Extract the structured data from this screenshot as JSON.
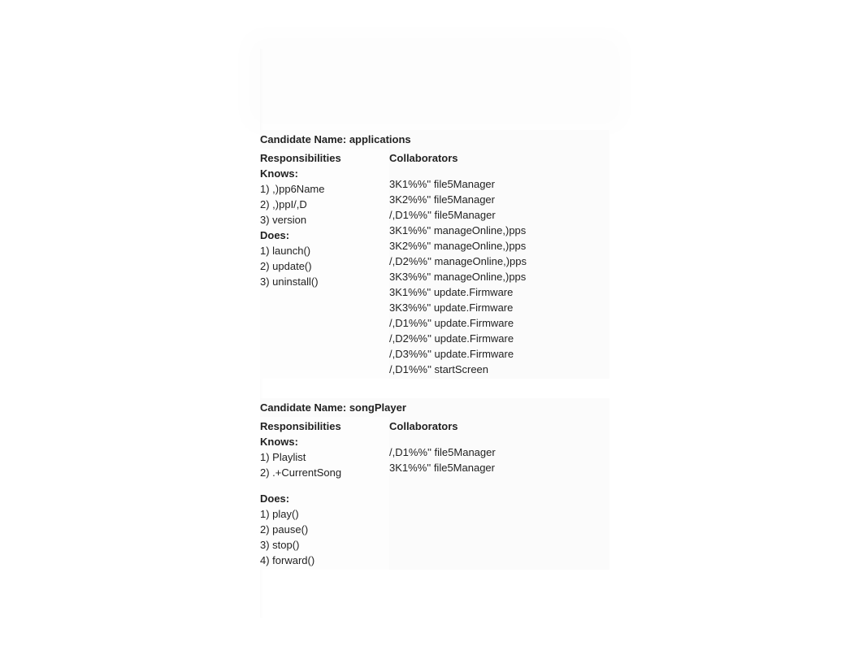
{
  "cards": [
    {
      "titlePrefix": "Candidate Name: ",
      "titleName": "applications",
      "respHeader": "Responsibilities",
      "collabHeader": "Collaborators",
      "knowsLabel": "Knows:",
      "knows": [
        "1) ,)pp6Name",
        "2) ,)ppI/,D",
        "3) version"
      ],
      "doesLabel": "Does:",
      "does": [
        "1) launch()",
        "2) update()",
        "3) uninstall()"
      ],
      "collabs": [
        "3K1%%'' file5Manager",
        "3K2%%'' file5Manager",
        "/,D1%%'' file5Manager",
        "3K1%%'' manageOnline,)pps",
        "3K2%%'' manageOnline,)pps",
        "/,D2%%'' manageOnline,)pps",
        "3K3%%'' manageOnline,)pps",
        "3K1%%'' update.Firmware",
        "3K3%%'' update.Firmware",
        "/,D1%%'' update.Firmware",
        "/,D2%%'' update.Firmware",
        "/,D3%%'' update.Firmware",
        "/,D1%%'' startScreen"
      ]
    },
    {
      "titlePrefix": "Candidate Name: ",
      "titleName": "songPlayer",
      "respHeader": "Responsibilities",
      "collabHeader": "Collaborators",
      "knowsLabel": "Knows:",
      "knows": [
        "1) Playlist",
        "2) .+CurrentSong"
      ],
      "doesLabel": "Does:",
      "does": [
        "1) play()",
        "2) pause()",
        "3) stop()",
        "4) forward()"
      ],
      "collabs": [
        "/,D1%%'' file5Manager",
        "3K1%%'' file5Manager"
      ]
    }
  ]
}
